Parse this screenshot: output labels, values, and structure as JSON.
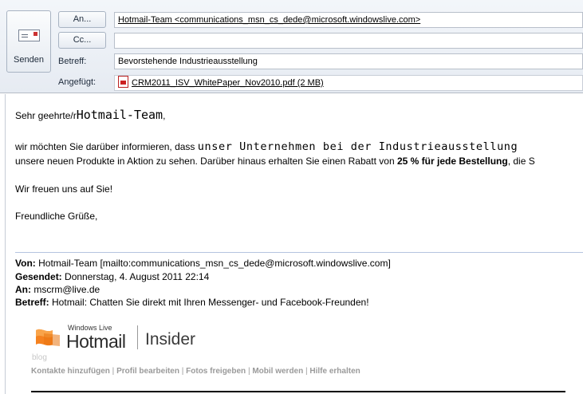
{
  "toolbar": {
    "send_label": "Senden"
  },
  "fields": {
    "to_button": "An...",
    "cc_button": "Cc...",
    "to_value": "Hotmail-Team <communications_msn_cs_dede@microsoft.windowslive.com>",
    "cc_value": "",
    "subject_label": "Betreff:",
    "subject_value": "Bevorstehende Industrieausstellung",
    "attached_label": "Angefügt:",
    "attachment_name": "CRM2011_ISV_WhitePaper_Nov2010.pdf (2 MB)"
  },
  "body": {
    "greeting_prefix": "Sehr geehrte/r",
    "greeting_name": "Hotmail-Team",
    "greeting_suffix": ",",
    "line1_prefix": "wir möchten Sie darüber informieren, dass",
    "line1_mono": "unser Unternehmen bei der Industrieausstellung",
    "line2_prefix": "unsere neuen Produkte in Aktion zu sehen. Darüber hinaus erhalten Sie einen Rabatt von",
    "line2_bold": "25 % für jede Bestellung",
    "line2_suffix": ", die S",
    "line3": "Wir freuen uns auf Sie!",
    "line4": "Freundliche Grüße,"
  },
  "quoted": {
    "from_label": "Von:",
    "from_value": "Hotmail-Team [mailto:communications_msn_cs_dede@microsoft.windowslive.com]",
    "sent_label": "Gesendet:",
    "sent_value": "Donnerstag, 4. August 2011 22:14",
    "to_label": "An:",
    "to_value": "mscrm@live.de",
    "subject_label": "Betreff:",
    "subject_value": "Hotmail: Chatten Sie direkt mit Ihren Messenger- und Facebook-Freunden!"
  },
  "logo": {
    "windows_live": "Windows Live",
    "hotmail": "Hotmail",
    "insider": "Insider",
    "blog": "blog"
  },
  "footer_links": [
    "Kontakte hinzufügen",
    "Profil bearbeiten",
    "Fotos freigeben",
    "Mobil werden",
    "Hilfe erhalten"
  ],
  "colors": {
    "header_bg": "#e6ebf2",
    "separator": "#b5c4df",
    "hotmail_orange": "#f58220"
  },
  "icons": {
    "send": "envelope-send-icon",
    "attachment": "pdf-file-icon",
    "logo": "windows-live-flag-icon"
  }
}
